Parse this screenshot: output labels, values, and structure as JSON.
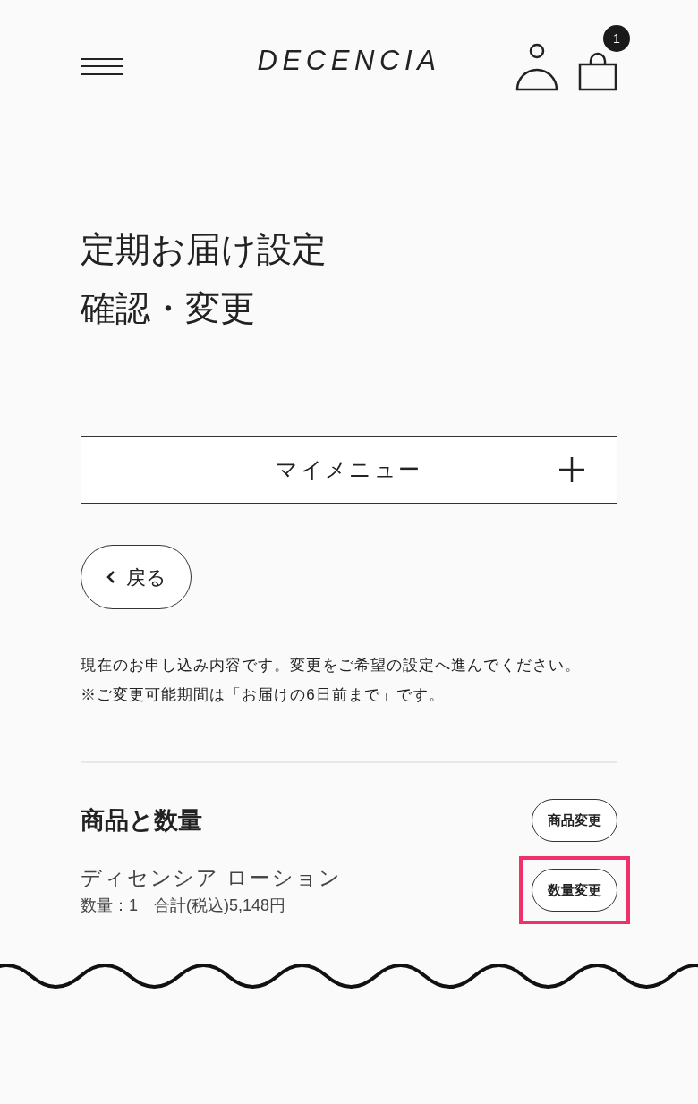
{
  "header": {
    "logo": "DECENCIA",
    "cart_count": "1"
  },
  "title_lines": [
    "定期お届け設定",
    "確認・変更"
  ],
  "my_menu": {
    "label": "マイメニュー",
    "expanded": false
  },
  "back_button": {
    "label": "戻る"
  },
  "notice": [
    "現在のお申し込み内容です。変更をご希望の設定へ進んでください。",
    "※ご変更可能期間は「お届けの6日前まで」です。"
  ],
  "section": {
    "title": "商品と数量",
    "action": {
      "label": "商品変更",
      "highlighted": false
    }
  },
  "items": [
    {
      "name": "ディセンシア ローション",
      "detail": "数量：1　合計(税込)5,148円",
      "action": {
        "label": "数量変更",
        "highlighted": true
      }
    }
  ]
}
